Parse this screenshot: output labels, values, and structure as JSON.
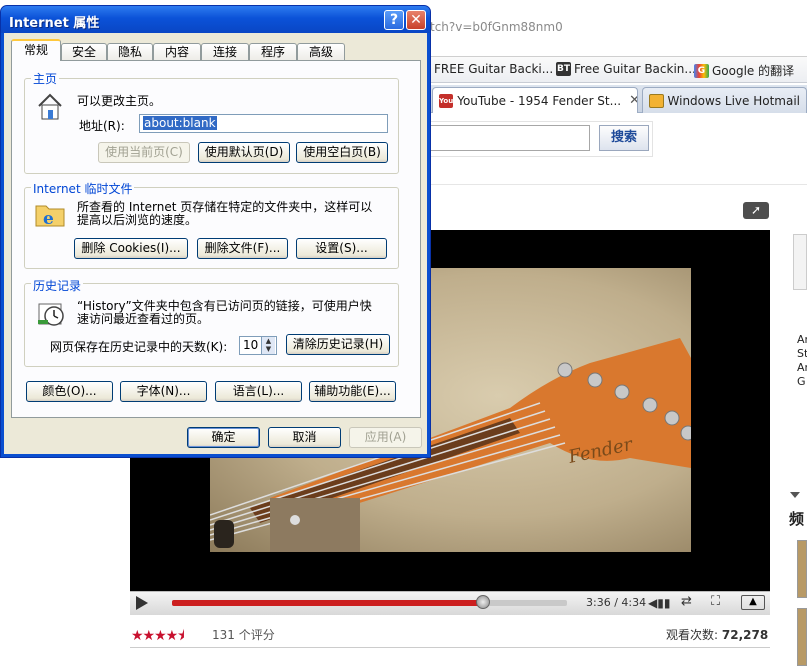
{
  "browser": {
    "url_fragment": "tch?v=b0fGnm88nm0",
    "bookmarks": [
      {
        "label": "FREE Guitar Backi...",
        "icon": "bookmark-icon"
      },
      {
        "label": "Free Guitar Backin...",
        "icon": "bt-icon"
      },
      {
        "label": "Google 的翻译",
        "icon": "google-icon"
      }
    ],
    "tabs": [
      {
        "label": "YouTube - 1954 Fender St...",
        "icon": "youtube-icon",
        "active": true
      },
      {
        "label": "Windows Live Hotmail",
        "icon": "hotmail-icon",
        "active": false
      }
    ],
    "tab_close": "✕",
    "search_button": "搜索"
  },
  "video": {
    "time": "3:36 / 4:34",
    "progress": 0.787,
    "rating_stars": 4.5,
    "ratings_text": "131 个评分",
    "views_label": "观看次数:",
    "views_value": "72,278",
    "share_icon": "share-icon"
  },
  "side": {
    "lines": [
      "Ar",
      "St",
      "Ar",
      "G"
    ],
    "freq": "频"
  },
  "dialog": {
    "title": "Internet 属性",
    "help": "?",
    "close": "✕",
    "tabs": [
      "常规",
      "安全",
      "隐私",
      "内容",
      "连接",
      "程序",
      "高级"
    ],
    "homepage": {
      "group_title": "主页",
      "desc": "可以更改主页。",
      "address_label": "地址(R):",
      "address_value": "about:blank",
      "btn_current": "使用当前页(C)",
      "btn_default": "使用默认页(D)",
      "btn_blank": "使用空白页(B)"
    },
    "temp": {
      "group_title": "Internet 临时文件",
      "desc_line1": "所查看的 Internet 页存储在特定的文件夹中，这样可以",
      "desc_line2": "提高以后浏览的速度。",
      "btn_cookies": "删除 Cookies(I)...",
      "btn_files": "删除文件(F)...",
      "btn_settings": "设置(S)..."
    },
    "history": {
      "group_title": "历史记录",
      "desc_line1": "“History”文件夹中包含有已访问页的链接，可使用户快",
      "desc_line2": "速访问最近查看过的页。",
      "days_label": "网页保存在历史记录中的天数(K):",
      "days_value": "10",
      "btn_clear": "清除历史记录(H)"
    },
    "bottom_buttons": [
      "颜色(O)...",
      "字体(N)...",
      "语言(L)...",
      "辅助功能(E)..."
    ],
    "ok": "确定",
    "cancel": "取消",
    "apply": "应用(A)"
  }
}
